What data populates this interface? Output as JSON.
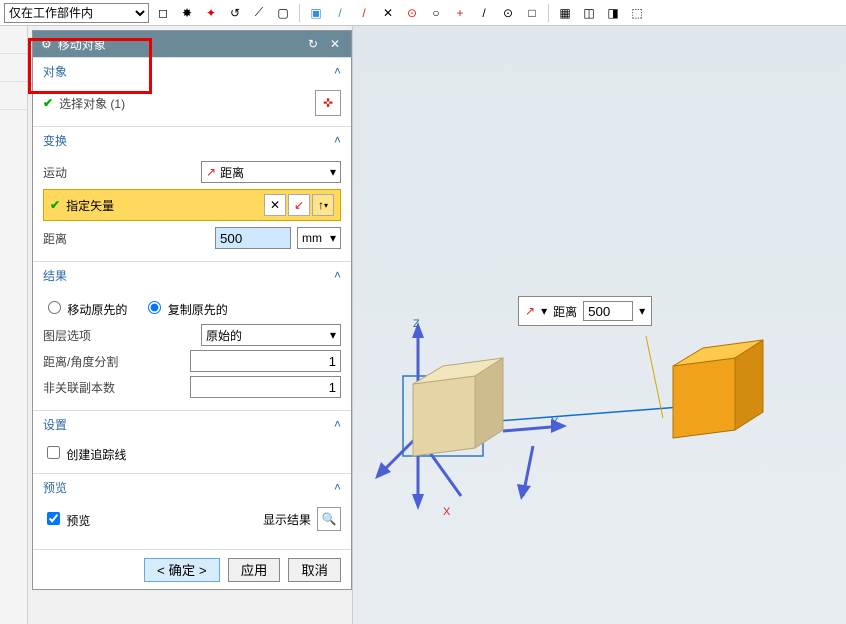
{
  "topbar": {
    "filter": "仅在工作部件内"
  },
  "panel": {
    "title": "移动对象",
    "sections": {
      "objects": {
        "title": "对象",
        "select_label": "选择对象 (1)"
      },
      "transform": {
        "title": "变换",
        "motion_label": "运动",
        "motion_value": "距离",
        "vector_label": "指定矢量",
        "distance_label": "距离",
        "distance_value": "500",
        "distance_unit": "mm"
      },
      "result": {
        "title": "结果",
        "radio1": "移动原先的",
        "radio2": "复制原先的",
        "layer_label": "图层选项",
        "layer_value": "原始的",
        "div_label": "距离/角度分割",
        "div_value": "1",
        "copies_label": "非关联副本数",
        "copies_value": "1"
      },
      "settings": {
        "title": "设置",
        "trace": "创建追踪线"
      },
      "preview": {
        "title": "预览",
        "cb": "预览",
        "show": "显示结果"
      }
    }
  },
  "footer": {
    "ok": "< 确定 >",
    "apply": "应用",
    "cancel": "取消"
  },
  "floater": {
    "label": "距离",
    "value": "500"
  },
  "axes": {
    "x": "X",
    "y": "Y",
    "z": "Z"
  }
}
